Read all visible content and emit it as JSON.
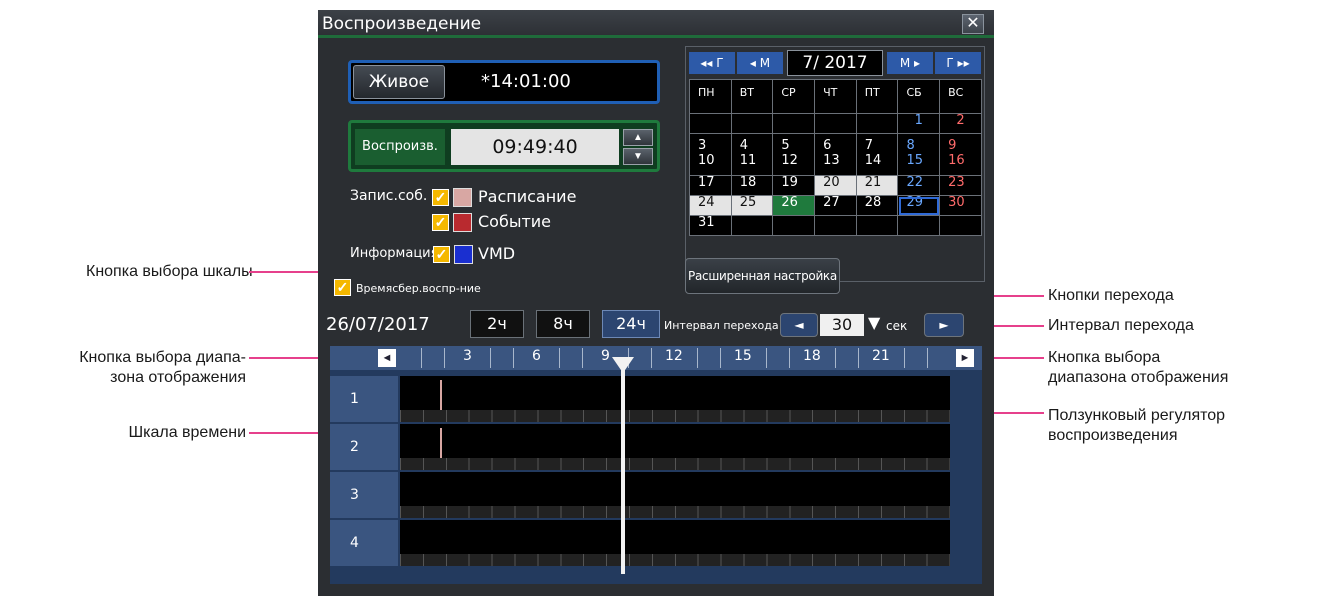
{
  "window": {
    "title": "Воспроизведение",
    "close_label": "✕"
  },
  "live": {
    "button_label": "Живое",
    "time": "*14:01:00"
  },
  "playback": {
    "button_label": "Воспроизв.",
    "time": "09:49:40",
    "up_label": "▲",
    "down_label": "▼"
  },
  "record_events": {
    "label": "Запис.соб.",
    "items": [
      {
        "label": "Расписание",
        "color": "#d8a7a3",
        "checked": true
      },
      {
        "label": "Событие",
        "color": "#b92a2f",
        "checked": true
      }
    ]
  },
  "information": {
    "label": "Информация",
    "item_label": "VMD",
    "color": "#1a2fd0",
    "checked": true
  },
  "time_sync": {
    "label": "Времясбер.воспр-ние",
    "checked": true
  },
  "calendar": {
    "nav": {
      "prev_year": "◂◂ Г",
      "prev_month": "◂ М",
      "month": "7/ 2017",
      "next_month": "М ▸",
      "next_year": "Г ▸▸"
    },
    "weekdays": [
      "ПН",
      "ВТ",
      "СР",
      "ЧТ",
      "ПТ",
      "СБ",
      "ВС"
    ],
    "weeks": [
      [
        "",
        "",
        "",
        "",
        "",
        "1",
        "2"
      ],
      [
        "3\n10",
        "4\n11",
        "5\n12",
        "6\n13",
        "7\n14",
        "8\n15",
        "9\n16"
      ],
      [
        "17",
        "18",
        "19",
        "20",
        "21",
        "22",
        "23"
      ],
      [
        "24",
        "25",
        "26",
        "27",
        "28",
        "29",
        "30"
      ],
      [
        "31",
        "",
        "",
        "",
        "",
        "",
        ""
      ]
    ]
  },
  "advanced_button": "Расширенная настройка",
  "scale": {
    "date": "26/07/2017",
    "buttons": [
      "2ч",
      "8ч",
      "24ч"
    ],
    "jump_interval_label": "Интервал перехода",
    "jump_prev": "◄",
    "jump_value": "30",
    "jump_dropdown": "▼",
    "jump_unit": "сек",
    "jump_next": "►"
  },
  "timeline": {
    "hours": [
      "3",
      "6",
      "9",
      "12",
      "15",
      "18",
      "21"
    ],
    "left_arrow": "◄",
    "right_arrow": "►",
    "cameras": [
      "1",
      "2",
      "3",
      "4"
    ]
  },
  "annotations": {
    "scale_select": "Кнопка выбора шкалы",
    "range_left_1": "Кнопка выбора диапа-",
    "range_left_2": "зона отображения",
    "time_scale": "Шкала времени",
    "jump_buttons": "Кнопки перехода",
    "jump_interval": "Интервал перехода",
    "range_right_1": "Кнопка выбора",
    "range_right_2": "диапазона отображения",
    "slider_1": "Ползунковый регулятор",
    "slider_2": "воспроизведения"
  }
}
